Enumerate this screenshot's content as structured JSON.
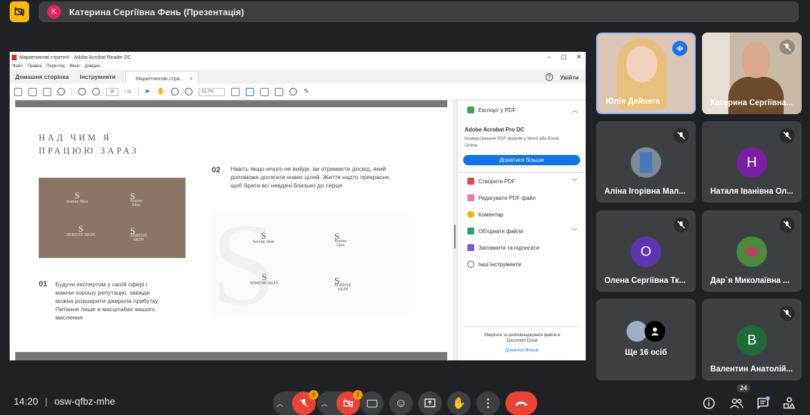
{
  "presenter": {
    "avatar_letter": "K",
    "title": "Катерина Сергіївна Фень (Презентація)",
    "avatar_color": "#e91e63"
  },
  "acrobat": {
    "window_title": "Маркетингові стратегії - Adobe Acrobat Reader DC",
    "menu": [
      "Файл",
      "Правка",
      "Перегляд",
      "Вікно",
      "Довідка"
    ],
    "tabs": {
      "home": "Домашня сторінка",
      "tools": "Інструменти",
      "doc": "Маркетингові стра...",
      "close": "×"
    },
    "help": "?",
    "signin": "Увійти",
    "page_current": "10",
    "page_total": "/ 11",
    "zoom": "52,7%",
    "document": {
      "heading_line1": "НАД ЧИМ Я",
      "heading_line2": "ПРАЦЮЮ ЗАРАЗ",
      "num1": "01",
      "text1_lines": [
        "Будучи експертом у своїй сфері і",
        "маючи хорошу репутацію, завжди",
        "можна розширити джирнла прибутку.",
        "Питання лише в масштабах вашого",
        "мислення"
      ],
      "num2": "02",
      "text2_lines": [
        "Навіть якщо нічого не вийде, ви отримаєте досвід, який",
        "допоможе досягати нових цілей. Життя надто прекрасне,",
        "щоб брати всі невдачі близько до серця"
      ],
      "logo_s": "S",
      "logo_serene_skin": "Serene Skin",
      "logo_serene_skin_caps": "SERENE SKIN",
      "logo_serene": "SERENE",
      "logo_skin_caps": "SKIN",
      "logo_serene_t": "Serene",
      "logo_skin_t": "Skin"
    },
    "pane": {
      "export": "Експорт у PDF",
      "product": "Adobe Acrobat Pro DC",
      "desc_lines": [
        "Конвертування PDF-файлів у Word або Excel",
        "Online"
      ],
      "learn_btn": "Дізнатися більше",
      "tools": [
        "Створити PDF",
        "Редагувати PDF-файл",
        "Коментар",
        "Об'єднати файли",
        "Заповнити та підписати",
        "Інші інструменти"
      ],
      "footer_lines": [
        "Зберігати та розповсюджувати файли в",
        "Document Cloud"
      ],
      "footer_link": "Дізнатися більше"
    }
  },
  "participants": [
    {
      "name": "Юлія Дейнега"
    },
    {
      "name": "Катерина Сергіївна..."
    },
    {
      "name": "Аліна Ігорівна Мал..."
    },
    {
      "name": "Наталя Іванівна Ол...",
      "letter": "Н",
      "color": "#7b1fa2"
    },
    {
      "name": "Олена Сергіївна Тк...",
      "letter": "О",
      "color": "#5e35b1"
    },
    {
      "name": "Дар`я Миколаївна ..."
    },
    {
      "name": "Ще 16 осіб"
    },
    {
      "name": "Валентин Анатолій...",
      "letter": "В",
      "color": "#1e6b3a"
    }
  ],
  "bottom": {
    "time": "14:20",
    "meeting_code": "osw-qfbz-mhe",
    "people_count": "24",
    "alert": "!"
  }
}
